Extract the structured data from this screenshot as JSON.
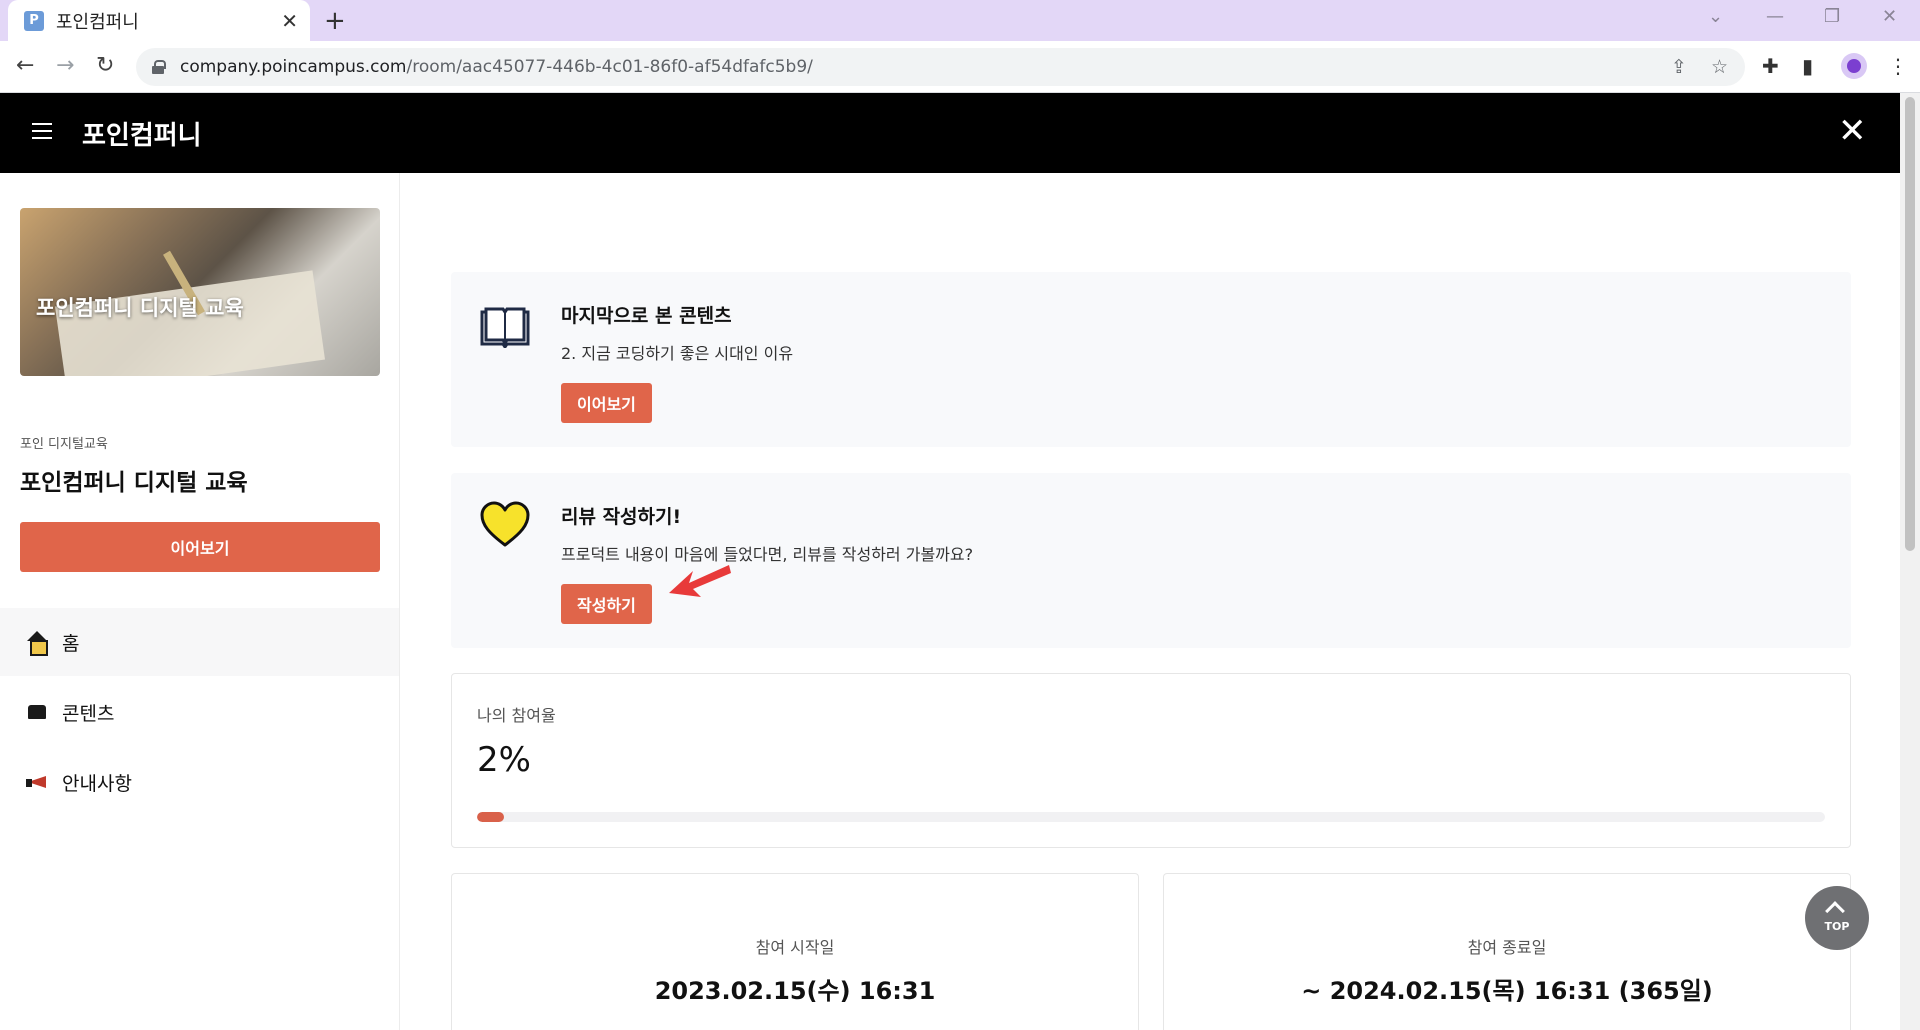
{
  "browser": {
    "tab_title": "포인컴퍼니",
    "favicon_letter": "P",
    "url_host": "company.poincampus.com",
    "url_path": "/room/aac45077-446b-4c01-86f0-af54dfafc5b9/"
  },
  "header": {
    "title": "포인컴퍼니"
  },
  "sidebar": {
    "thumbnail_title": "포인컴퍼니 디지털 교육",
    "course_category": "포인 디지털교육",
    "course_name": "포인컴퍼니 디지털 교육",
    "continue_label": "이어보기",
    "nav": [
      {
        "label": "홈",
        "icon": "home-icon",
        "active": true
      },
      {
        "label": "콘텐츠",
        "icon": "contents-icon",
        "active": false
      },
      {
        "label": "안내사항",
        "icon": "megaphone-icon",
        "active": false
      }
    ]
  },
  "last_viewed": {
    "title": "마지막으로 본 콘텐츠",
    "desc": "2. 지금 코딩하기 좋은 시대인 이유",
    "button": "이어보기",
    "icon": "book-icon"
  },
  "review": {
    "title": "리뷰 작성하기!",
    "desc": "프로덕트 내용이 마음에 들었다면, 리뷰를 작성하러 가볼까요?",
    "button": "작성하기",
    "icon": "heart-icon"
  },
  "participation": {
    "label": "나의 참여율",
    "value": "2%",
    "progress": 0.02
  },
  "dates": {
    "start_label": "참여 시작일",
    "start_value": "2023.02.15(수) 16:31",
    "end_label": "참여 종료일",
    "end_value": "~ 2024.02.15(목) 16:31 (365일)"
  },
  "top_button": {
    "label": "TOP"
  },
  "colors": {
    "accent": "#e0654a",
    "header_bg": "#000000",
    "tabbar_bg": "#e3d7f7"
  }
}
